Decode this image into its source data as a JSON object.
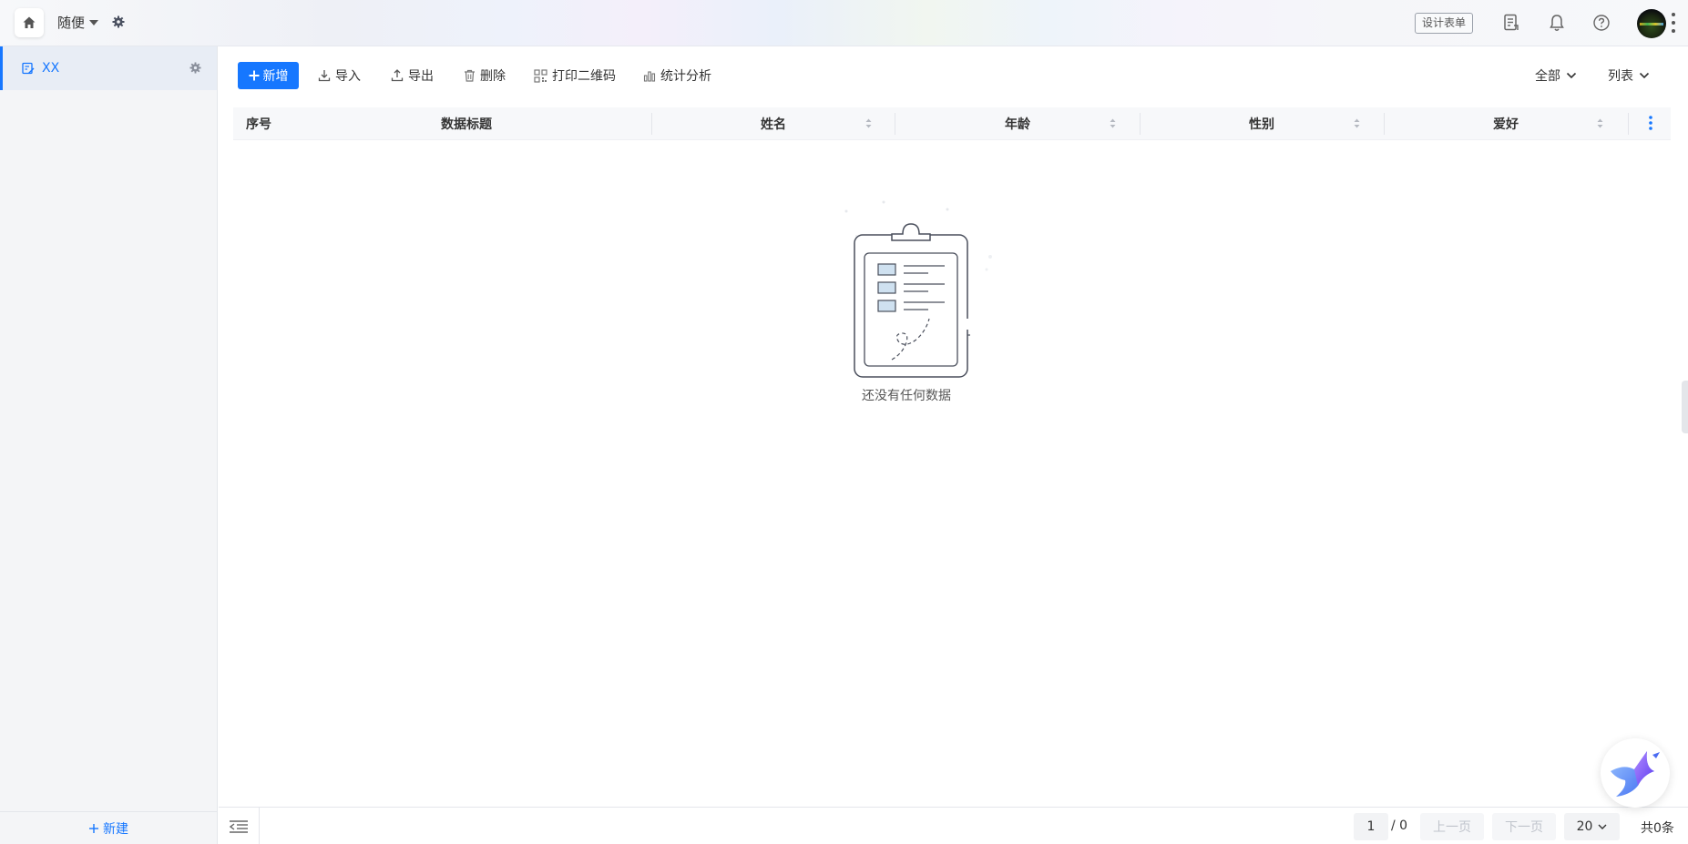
{
  "topbar": {
    "app_name": "随便",
    "design_button": "设计表单",
    "icons": [
      "home-icon",
      "caret-down-icon",
      "gear-icon",
      "form-doc-icon",
      "bell-icon",
      "help-icon",
      "more-vertical-icon"
    ]
  },
  "sidebar": {
    "items": [
      {
        "label": "XX",
        "active": true,
        "icon": "form-edit-icon"
      }
    ],
    "new_label": "新建"
  },
  "toolbar": {
    "add_label": "新增",
    "import_label": "导入",
    "export_label": "导出",
    "delete_label": "删除",
    "print_qr_label": "打印二维码",
    "stats_label": "统计分析",
    "filter_label": "全部",
    "view_label": "列表"
  },
  "table": {
    "columns": [
      "序号",
      "数据标题",
      "姓名",
      "年龄",
      "性别",
      "爱好"
    ],
    "rows": []
  },
  "empty": {
    "text": "还没有任何数据"
  },
  "pagination": {
    "current_page": "1",
    "total_pages": "/ 0",
    "prev_label": "上一页",
    "next_label": "下一页",
    "page_size": "20",
    "total_count": "共0条"
  },
  "colors": {
    "accent": "#1677ff",
    "sidebar_bg": "#f4f5f7",
    "header_bg": "#f7f8fa"
  }
}
